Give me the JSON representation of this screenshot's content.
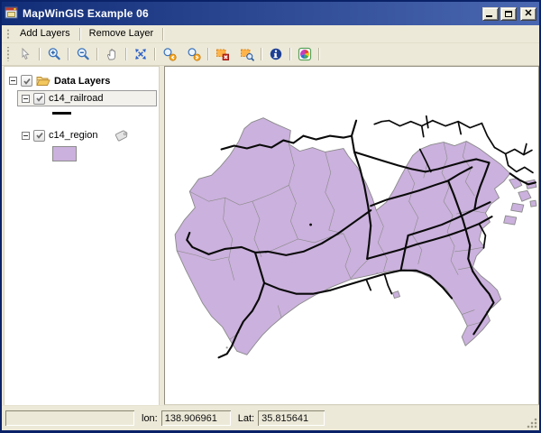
{
  "window": {
    "title": "MapWinGIS Example 06",
    "caption_buttons": {
      "minimize": "_",
      "maximize": "",
      "close": "×"
    }
  },
  "menu": {
    "items": [
      {
        "label": "Add Layers"
      },
      {
        "label": "Remove Layer"
      }
    ]
  },
  "toolbar": {
    "buttons": [
      "select-pointer",
      "zoom-in",
      "zoom-out",
      "pan-hand",
      "zoom-extents",
      "zoom-previous",
      "zoom-next",
      "remove-all-layers",
      "zoom-to-layer",
      "identify-info",
      "symbology-colors"
    ]
  },
  "legend": {
    "group_label": "Data Layers",
    "layers": [
      {
        "name": "c14_railroad",
        "checked": true,
        "selected": true,
        "symbol_type": "line"
      },
      {
        "name": "c14_region",
        "checked": true,
        "selected": false,
        "symbol_type": "polygon-fill",
        "has_tag": true
      }
    ]
  },
  "statusbar": {
    "lon_label": "lon:",
    "lon_value": "138.906961",
    "lat_label": "Lat:",
    "lat_value": "35.815641"
  },
  "map": {
    "description": "Kanagawa prefecture municipalities (purple polygons) with railroad network (black lines)"
  },
  "colors": {
    "titlebar_left": "#122d77",
    "titlebar_right": "#4a67b1",
    "window_border": "#0a2268",
    "chrome": "#ece9d8",
    "selection_bg": "#f2f1ec",
    "region_fill": "#cbb1dd",
    "region_border": "#8a8a8a",
    "railroad": "#0a0a0a",
    "info_blue": "#1e3f94",
    "accent_orange": "#f6a623"
  }
}
